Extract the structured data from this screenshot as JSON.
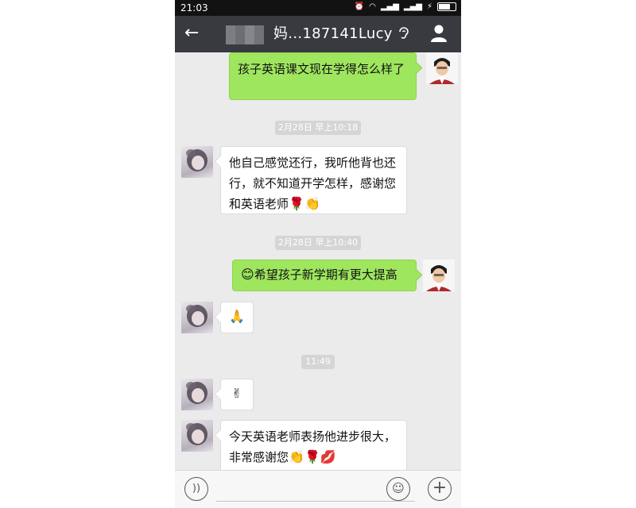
{
  "status_bar": {
    "time": "21:03",
    "icons": [
      "alarm-icon",
      "wifi-icon",
      "signal-icon",
      "signal-icon",
      "charging-icon",
      "battery-icon"
    ]
  },
  "header": {
    "back_icon": "back-arrow-icon",
    "title": "妈...187141Lucy",
    "ear_icon": "earpiece-mode-icon",
    "profile_icon": "person-icon",
    "bg_color": "#393a3f"
  },
  "messages": {
    "m1": {
      "side": "out",
      "text": "孩子英语课文现在学得怎么样了"
    },
    "ts1": "2月28日 早上10:18",
    "m2": {
      "side": "in",
      "text": "他自己感觉还行，我听他背也还行，就不知道开学怎样，感谢您和英语老师",
      "emoji": "🌹👏"
    },
    "ts2": "2月28日 早上10:40",
    "m3": {
      "side": "out",
      "emoji": "😊",
      "text": "希望孩子新学期有更大提高"
    },
    "m4": {
      "side": "in",
      "emoji": "🙏"
    },
    "ts3": "11:49",
    "m5": {
      "side": "in",
      "emoji": "✌"
    },
    "m6": {
      "side": "in",
      "text": "今天英语老师表扬他进步很大，非常感谢您",
      "emoji": "👏🌹💋"
    }
  },
  "input_bar": {
    "voice_icon": "voice-input-icon",
    "emoji_icon": "emoji-icon",
    "more_icon": "plus-icon"
  },
  "colors": {
    "outgoing_bubble": "#9fe65f",
    "incoming_bubble": "#ffffff",
    "chat_bg": "#ebebeb"
  }
}
